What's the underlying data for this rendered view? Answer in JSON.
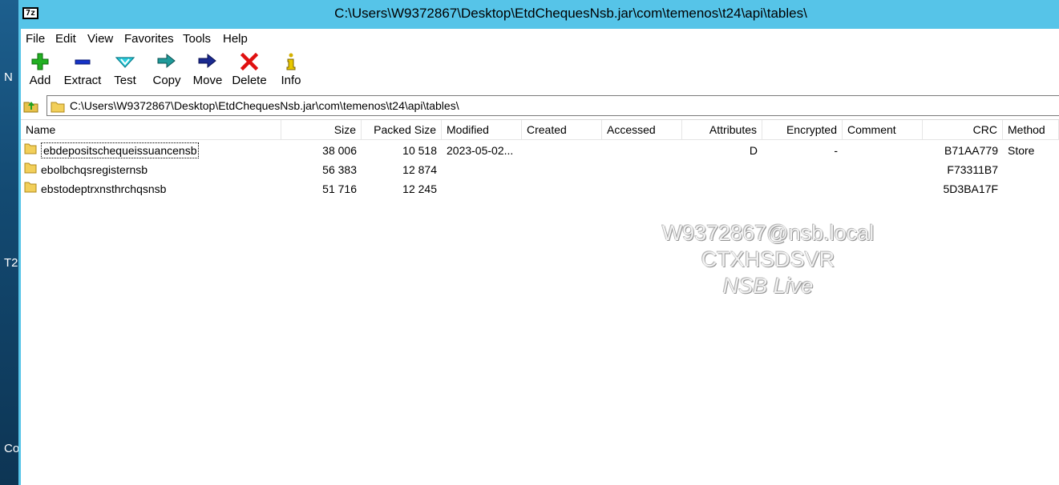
{
  "desktop": {
    "fragments": [
      "N",
      "T2",
      "Co"
    ]
  },
  "window": {
    "title": "C:\\Users\\W9372867\\Desktop\\EtdChequesNsb.jar\\com\\temenos\\t24\\api\\tables\\",
    "app_icon_text": "7z"
  },
  "menu": [
    "File",
    "Edit",
    "View",
    "Favorites",
    "Tools",
    "Help"
  ],
  "toolbar": [
    {
      "label": "Add",
      "icon": "plus-icon",
      "color": "#1aa11a"
    },
    {
      "label": "Extract",
      "icon": "minus-icon",
      "color": "#1030c8"
    },
    {
      "label": "Test",
      "icon": "check-icon",
      "color": "#19b7c9"
    },
    {
      "label": "Copy",
      "icon": "double-arrow-icon",
      "color": "#1a8f8f"
    },
    {
      "label": "Move",
      "icon": "arrow-right-icon",
      "color": "#1a2b8f"
    },
    {
      "label": "Delete",
      "icon": "x-icon",
      "color": "#e01010"
    },
    {
      "label": "Info",
      "icon": "info-icon",
      "color": "#c9a800"
    }
  ],
  "address": {
    "path": "C:\\Users\\W9372867\\Desktop\\EtdChequesNsb.jar\\com\\temenos\\t24\\api\\tables\\"
  },
  "columns": [
    "Name",
    "Size",
    "Packed Size",
    "Modified",
    "Created",
    "Accessed",
    "Attributes",
    "Encrypted",
    "Comment",
    "CRC",
    "Method"
  ],
  "rows": [
    {
      "name": "ebdepositschequeissuancensb",
      "size": "38 006",
      "packed": "10 518",
      "modified": "2023-05-02...",
      "created": "",
      "accessed": "",
      "attributes": "D",
      "encrypted": "-",
      "comment": "",
      "crc": "B71AA779",
      "method": "Store"
    },
    {
      "name": "ebolbchqsregisternsb",
      "size": "56 383",
      "packed": "12 874",
      "modified": "",
      "created": "",
      "accessed": "",
      "attributes": "",
      "encrypted": "",
      "comment": "",
      "crc": "F73311B7",
      "method": ""
    },
    {
      "name": "ebstodeptrxnsthrchqsnsb",
      "size": "51 716",
      "packed": "12 245",
      "modified": "",
      "created": "",
      "accessed": "",
      "attributes": "",
      "encrypted": "",
      "comment": "",
      "crc": "5D3BA17F",
      "method": ""
    }
  ],
  "watermark": {
    "line1": "W9372867@nsb.local",
    "line2": "CTXHSDSVR",
    "line3": "NSB Live"
  }
}
